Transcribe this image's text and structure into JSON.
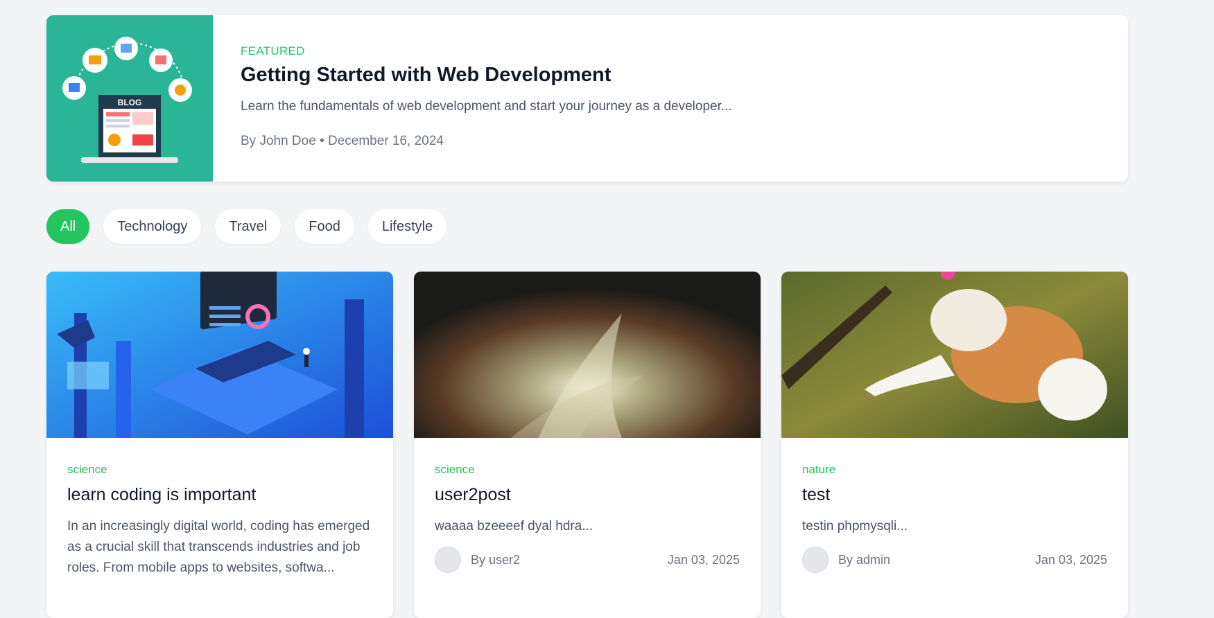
{
  "featured": {
    "tag": "FEATURED",
    "title": "Getting Started with Web Development",
    "excerpt": "Learn the fundamentals of web development and start your journey as a developer...",
    "meta": "By John Doe • December 16, 2024",
    "thumb_text": "BLOG"
  },
  "filters": [
    "All",
    "Technology",
    "Travel",
    "Food",
    "Lifestyle"
  ],
  "active_filter": "All",
  "cards": [
    {
      "category": "science",
      "title": "learn coding is important",
      "excerpt": "In an increasingly digital world, coding has emerged as a crucial skill that transcends industries and job roles. From mobile apps to websites, softwa...",
      "author": "",
      "date": ""
    },
    {
      "category": "science",
      "title": "user2post",
      "excerpt": "waaaa bzeeeef dyal hdra...",
      "author": "By user2",
      "date": "Jan 03, 2025"
    },
    {
      "category": "nature",
      "title": "test",
      "excerpt": "testin phpmysqli...",
      "author": "By admin",
      "date": "Jan 03, 2025"
    }
  ],
  "colors": {
    "accent": "#22c55e",
    "page_bg": "#f3f4f6",
    "featured_thumb_bg": "#2bb597"
  }
}
